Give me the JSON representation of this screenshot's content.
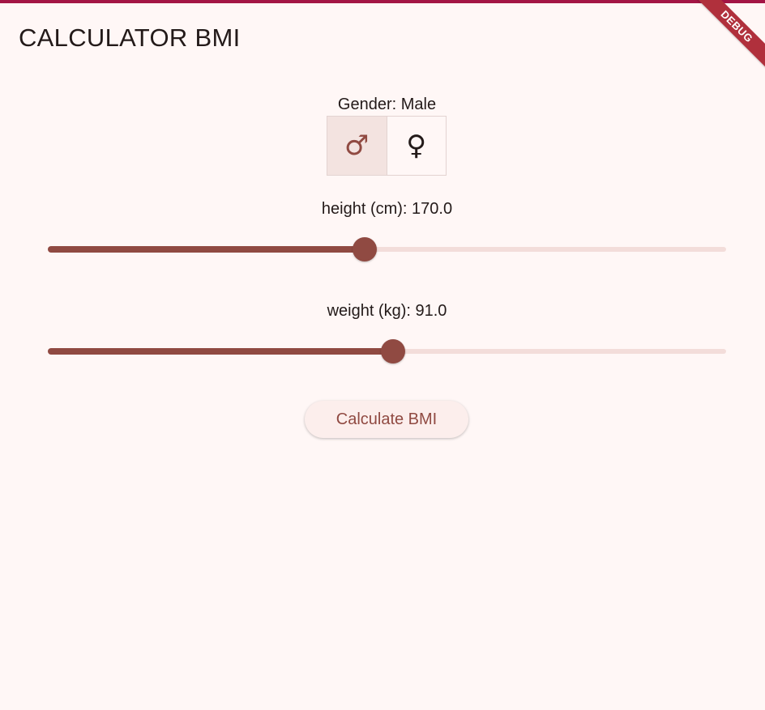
{
  "app": {
    "title": "CALCULATOR BMI",
    "debug_banner": "DEBUG"
  },
  "gender": {
    "label": "Gender: Male",
    "options": [
      {
        "icon": "male-icon",
        "glyph": "♂",
        "selected": true
      },
      {
        "icon": "female-icon",
        "glyph": "♀",
        "selected": false
      }
    ]
  },
  "height": {
    "label": "height (cm): 170.0",
    "value": 170.0,
    "fraction": 0.467
  },
  "weight": {
    "label": "weight (kg): 91.0",
    "value": 91.0,
    "fraction": 0.509
  },
  "actions": {
    "calculate_label": "Calculate BMI"
  },
  "colors": {
    "accent": "#904a42",
    "background": "#fff7f6",
    "track_inactive": "#f3ddda",
    "top_strip": "#a31545",
    "debug_banner": "#b0303c"
  }
}
